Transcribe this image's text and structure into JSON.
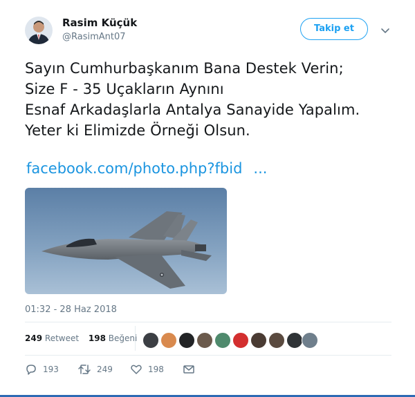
{
  "user": {
    "display_name": "Rasim Küçük",
    "screen_name": "@RasimAnt07",
    "avatar_icon": "user-avatar"
  },
  "follow_button": {
    "label": "Takip et"
  },
  "menu": {
    "icon": "chevron-down-icon"
  },
  "tweet": {
    "lines": [
      "Sayın Cumhurbaşkanım Bana Destek Verin;",
      "Size F - 35 Uçakların Aynını",
      "Esnaf Arkadaşlarla Antalya Sanayide Yapalım.",
      "Yeter ki Elimizde Örneği Olsun."
    ],
    "link_text": "facebook.com/photo.php?fbid",
    "link_ellipsis": "...",
    "timestamp": "01:32 - 28 Haz 2018"
  },
  "media": {
    "description_icon": "fighter-jet-photo"
  },
  "stats": {
    "retweets_count": "249",
    "retweets_label": "Retweet",
    "likes_count": "198",
    "likes_label": "Beğeni",
    "liker_avatar_count": 10
  },
  "actions": {
    "reply_count": "193",
    "retweet_count": "249",
    "like_count": "198"
  },
  "colors": {
    "accent": "#1da1f2",
    "link": "#1b95e0",
    "muted": "#657786",
    "text": "#14171a",
    "divider": "#e6ecf0"
  }
}
